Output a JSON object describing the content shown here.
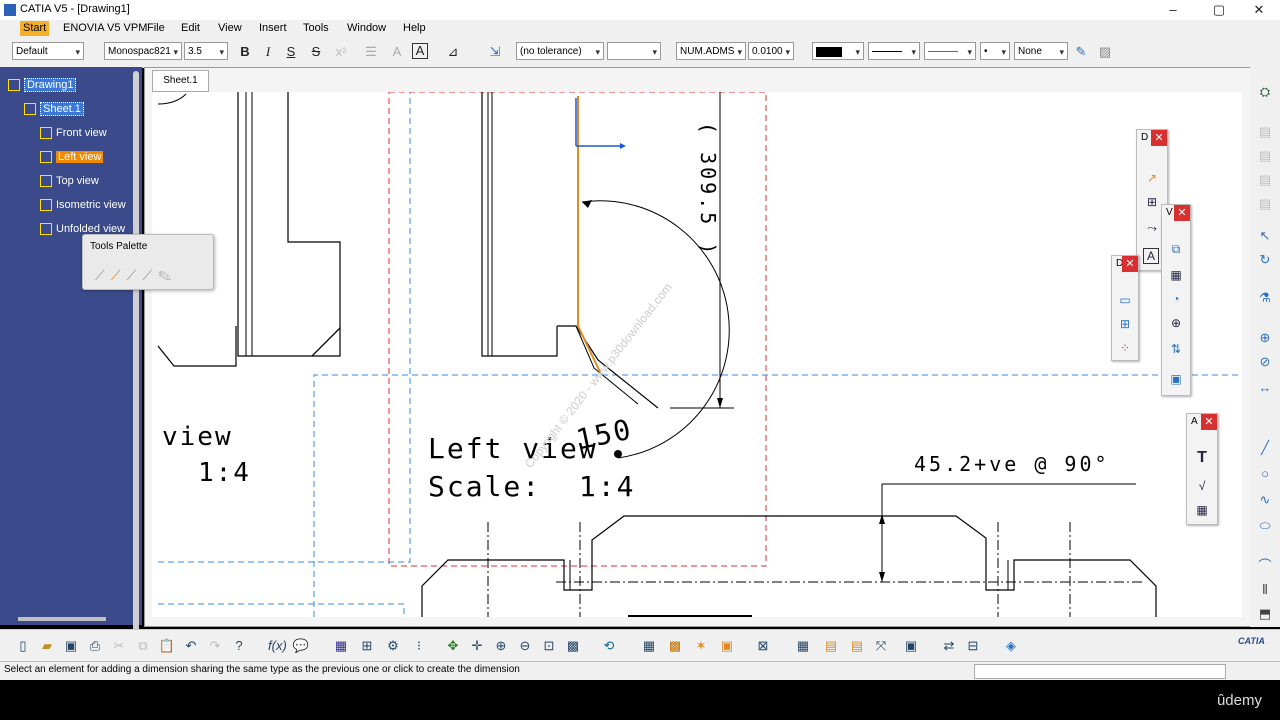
{
  "window": {
    "title": "CATIA V5 - [Drawing1]",
    "minimize": "–",
    "maximize": "▢",
    "close": "✕"
  },
  "menu": [
    "Start",
    "ENOVIA V5 VPM",
    "File",
    "Edit",
    "View",
    "Insert",
    "Tools",
    "Window",
    "Help"
  ],
  "toolbar": {
    "style_select": "Default",
    "font_select": "Monospac821",
    "size_select": "3.5",
    "bold": "B",
    "italic": "I",
    "underline": "S",
    "strike": "S",
    "tolerance_select": "(no tolerance)",
    "numformat_select": "NUM.ADMS",
    "precision_select": "0.0100",
    "linestyle_none": "None"
  },
  "tree": {
    "items": [
      {
        "label": "Drawing1"
      },
      {
        "label": "Sheet.1"
      },
      {
        "label": "Front view"
      },
      {
        "label": "Left view"
      },
      {
        "label": "Top view"
      },
      {
        "label": "Isometric view"
      },
      {
        "label": "Unfolded view"
      }
    ]
  },
  "palette": {
    "title": "Tools Palette"
  },
  "sheet_tab": "Sheet.1",
  "drawing": {
    "dim_vertical": "( 309.5 )",
    "dim_angle": "150",
    "left_view_title": "Left view",
    "left_view_scale": "Scale:  1:4",
    "prev_view_title": "view",
    "prev_view_scale": "1:4",
    "leader_note": "45.2+ve @ 90°",
    "watermark": "Copyright © 2020 - www.p30download.com"
  },
  "floating": {
    "t1_label": "D",
    "t2_label": "V",
    "t3_label": "D",
    "t4_label": "A",
    "close": "✕"
  },
  "status": {
    "message": "Select an element for adding a dimension sharing the same type as the previous one or click to create the dimension"
  },
  "branding": {
    "catia": "CATIA",
    "udemy": "ûdemy"
  },
  "colors": {
    "tree_bg": "#3a4a8a",
    "selection": "#f08a00",
    "accent_blue": "#2a62b8"
  }
}
